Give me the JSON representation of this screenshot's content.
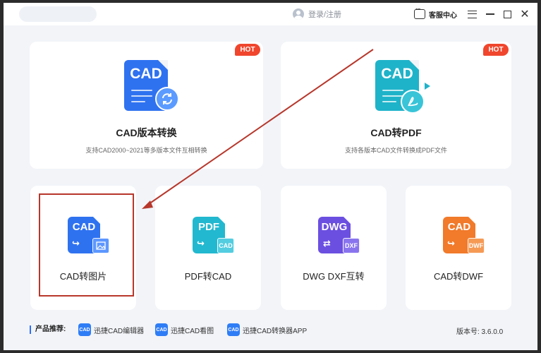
{
  "header": {
    "login_label": "登录/注册",
    "service_label": "客服中心"
  },
  "big_cards": [
    {
      "title": "CAD版本转换",
      "desc": "支持CAD2000~2021等多版本文件互相转换",
      "hot": "HOT",
      "icon_label": "CAD",
      "color": "#2f72f0"
    },
    {
      "title": "CAD转PDF",
      "desc": "支持各版本CAD文件转换成PDF文件",
      "hot": "HOT",
      "icon_label": "CAD",
      "color": "#1fb3c9"
    }
  ],
  "small_cards": [
    {
      "title": "CAD转图片",
      "icon_label": "CAD",
      "color": "#2f72f0"
    },
    {
      "title": "PDF转CAD",
      "icon_label": "PDF",
      "sub": "CAD",
      "color": "#22b8cf"
    },
    {
      "title": "DWG DXF互转",
      "icon_label": "DWG",
      "sub": "DXF",
      "color": "#6b4fe0"
    },
    {
      "title": "CAD转DWF",
      "icon_label": "CAD",
      "sub": "DWF",
      "color": "#f17a2b"
    }
  ],
  "footer": {
    "rec_label": "产品推荐:",
    "items": [
      {
        "label": "迅捷CAD编辑器",
        "icon": "CAD"
      },
      {
        "label": "迅捷CAD看图",
        "icon": "CAD"
      },
      {
        "label": "迅捷CAD转换器APP",
        "icon": "CAD"
      }
    ],
    "version": "版本号: 3.6.0.0"
  },
  "colors": {
    "accent": "#2d6ff7",
    "hot": "#f0462d",
    "highlight": "#b7372b"
  }
}
